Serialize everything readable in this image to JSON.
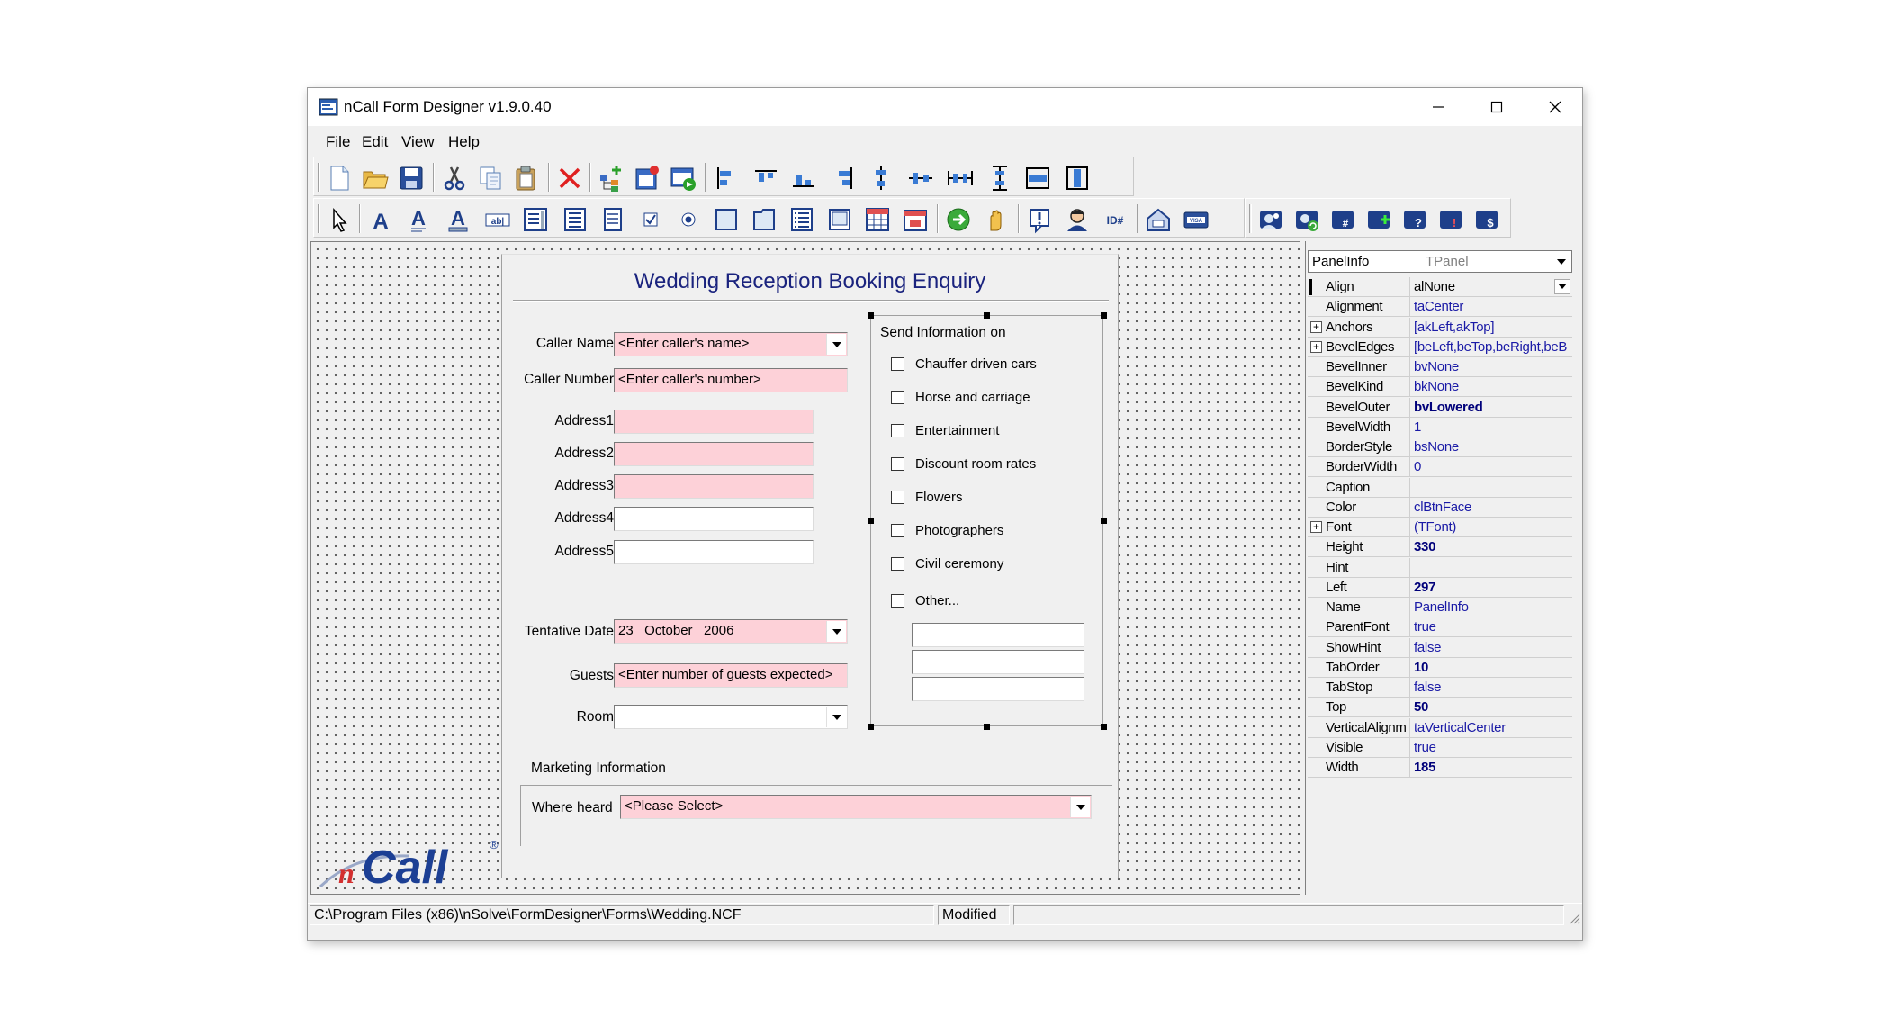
{
  "window": {
    "title": "nCall Form Designer v1.9.0.40"
  },
  "menu": {
    "file": {
      "underline": "F",
      "rest": "ile"
    },
    "edit": {
      "underline": "E",
      "rest": "dit"
    },
    "view": {
      "underline": "V",
      "rest": "iew"
    },
    "help": {
      "underline": "H",
      "rest": "elp"
    }
  },
  "form": {
    "title": "Wedding Reception Booking Enquiry",
    "labels": {
      "caller_name": "Caller Name",
      "caller_number": "Caller Number",
      "address1": "Address1",
      "address2": "Address2",
      "address3": "Address3",
      "address4": "Address4",
      "address5": "Address5",
      "tentative_date": "Tentative Date",
      "guests": "Guests",
      "room": "Room"
    },
    "values": {
      "caller_name": "<Enter caller's name>",
      "caller_number": "<Enter caller's number>",
      "tentative_date": "23   October   2006",
      "guests": "<Enter number of guests expected>",
      "room": ""
    },
    "send_info": {
      "heading": "Send Information on",
      "options": [
        "Chauffer driven cars",
        "Horse and carriage",
        "Entertainment",
        "Discount room rates",
        "Flowers",
        "Photographers",
        "Civil ceremony",
        "Other..."
      ]
    },
    "marketing": {
      "heading": "Marketing Information",
      "where_heard_label": "Where heard",
      "where_heard_value": "<Please Select>"
    }
  },
  "logo": {
    "text": "nCall",
    "registered": "®"
  },
  "inspector": {
    "component": "PanelInfo",
    "class": "TPanel",
    "properties": [
      {
        "name": "Align",
        "value": "alNone",
        "style": "black",
        "combo": true,
        "selected": true
      },
      {
        "name": "Alignment",
        "value": "taCenter"
      },
      {
        "name": "Anchors",
        "value": "[akLeft,akTop]",
        "expandable": true
      },
      {
        "name": "BevelEdges",
        "value": "[beLeft,beTop,beRight,beB",
        "expandable": true
      },
      {
        "name": "BevelInner",
        "value": "bvNone"
      },
      {
        "name": "BevelKind",
        "value": "bkNone"
      },
      {
        "name": "BevelOuter",
        "value": "bvLowered",
        "style": "bold"
      },
      {
        "name": "BevelWidth",
        "value": "1"
      },
      {
        "name": "BorderStyle",
        "value": "bsNone"
      },
      {
        "name": "BorderWidth",
        "value": "0"
      },
      {
        "name": "Caption",
        "value": ""
      },
      {
        "name": "Color",
        "value": "clBtnFace"
      },
      {
        "name": "Font",
        "value": "(TFont)",
        "expandable": true
      },
      {
        "name": "Height",
        "value": "330",
        "style": "bold"
      },
      {
        "name": "Hint",
        "value": ""
      },
      {
        "name": "Left",
        "value": "297",
        "style": "bold"
      },
      {
        "name": "Name",
        "value": "PanelInfo"
      },
      {
        "name": "ParentFont",
        "value": "true"
      },
      {
        "name": "ShowHint",
        "value": "false"
      },
      {
        "name": "TabOrder",
        "value": "10",
        "style": "bold"
      },
      {
        "name": "TabStop",
        "value": "false"
      },
      {
        "name": "Top",
        "value": "50",
        "style": "bold"
      },
      {
        "name": "VerticalAlignm",
        "value": "taVerticalCenter"
      },
      {
        "name": "Visible",
        "value": "true"
      },
      {
        "name": "Width",
        "value": "185",
        "style": "bold"
      }
    ]
  },
  "status": {
    "path": "C:\\Program Files (x86)\\nSolve\\FormDesigner\\Forms\\Wedding.NCF",
    "state": "Modified"
  },
  "icons": {
    "toolbar1": [
      "new-file-icon",
      "open-folder-icon",
      "save-icon",
      "cut-icon",
      "copy-icon",
      "paste-icon",
      "delete-icon",
      "tree-add-icon",
      "form-properties-icon",
      "form-run-icon",
      "align-left-icon",
      "align-top-icon",
      "align-bottom-icon",
      "align-right-icon",
      "align-center-vertical-icon",
      "align-center-horizontal-icon",
      "space-horizontal-icon",
      "space-vertical-icon",
      "same-height-icon",
      "same-width-icon"
    ],
    "toolbar2": [
      "pointer-icon",
      "label-icon",
      "multiline-label-icon",
      "underlined-label-icon",
      "edit-box-icon",
      "memo-icon",
      "list-icon",
      "document-icon",
      "checkbox-icon",
      "radio-icon",
      "panel-icon",
      "page-icon",
      "listbox-icon",
      "frame-icon",
      "grid-icon",
      "calendar-icon",
      "go-button-icon",
      "hand-icon",
      "alert-icon",
      "person-icon",
      "id-icon",
      "address-icon",
      "credit-card-icon",
      "lookup-icon",
      "lookup-refresh-icon",
      "lookup-number-icon",
      "lookup-add-icon",
      "lookup-help-icon",
      "lookup-alert-icon",
      "lookup-dollar-icon"
    ]
  },
  "colors": {
    "required_field": "#fdd1d8",
    "title_blue": "#1a237e",
    "property_value": "#1a1aa6",
    "logo_blue": "#1c3f94",
    "logo_red": "#d32f2f"
  }
}
